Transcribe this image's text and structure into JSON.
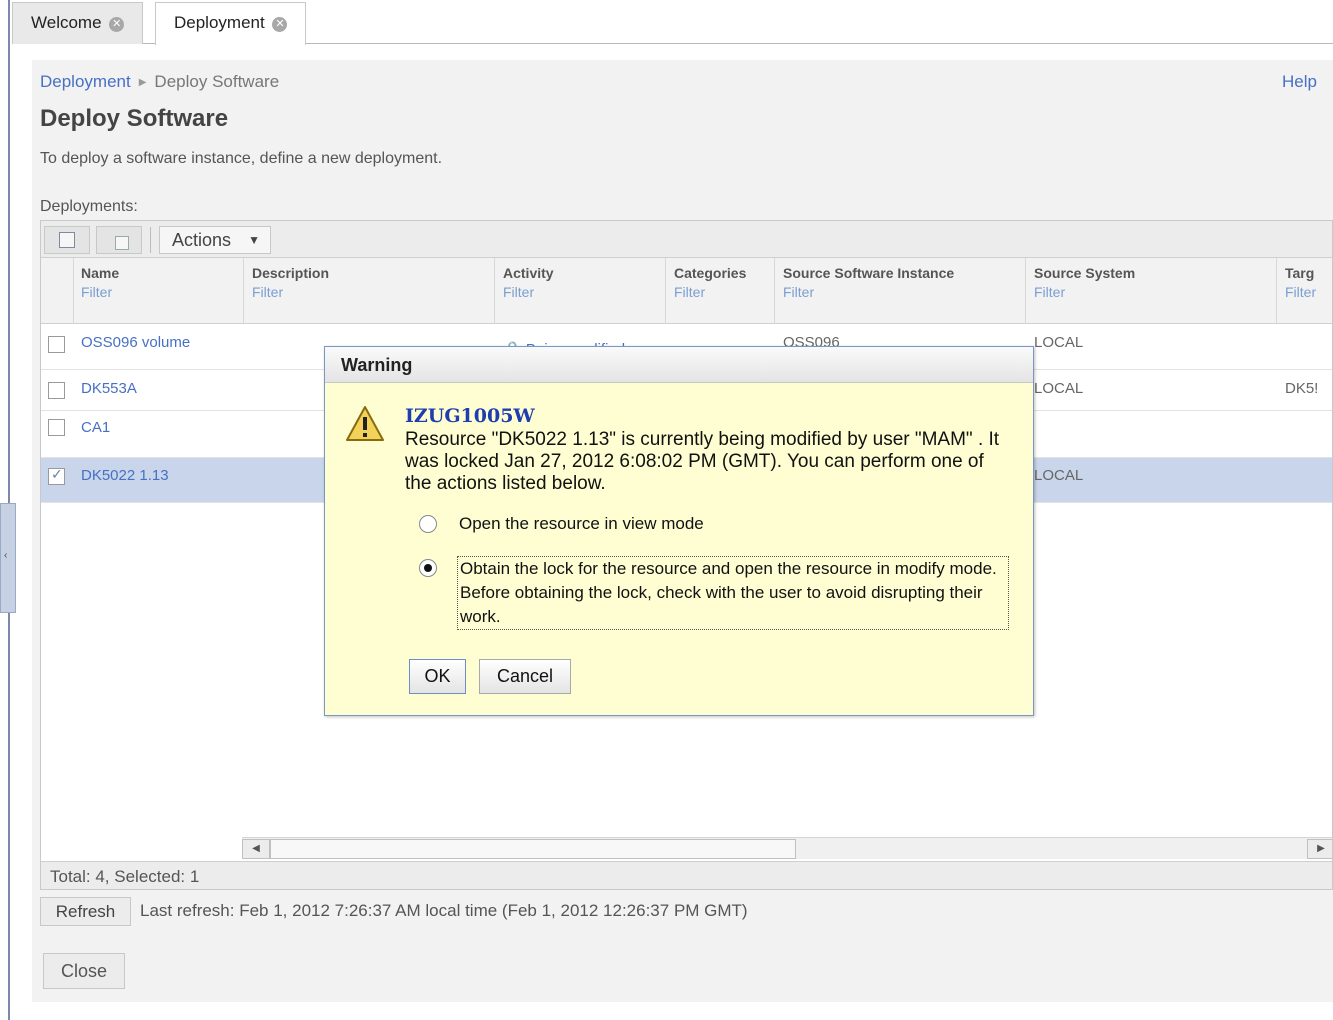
{
  "tabs": [
    {
      "label": "Welcome"
    },
    {
      "label": "Deployment"
    }
  ],
  "breadcrumb": {
    "parent": "Deployment",
    "current": "Deploy Software"
  },
  "help_label": "Help",
  "page_title": "Deploy Software",
  "intro_text": "To deploy a software instance, define a new deployment.",
  "deployments_label": "Deployments:",
  "toolbar": {
    "actions_label": "Actions"
  },
  "table": {
    "filter_label": "Filter",
    "columns": [
      {
        "name": "Name"
      },
      {
        "name": "Description"
      },
      {
        "name": "Activity"
      },
      {
        "name": "Categories"
      },
      {
        "name": "Source Software Instance"
      },
      {
        "name": "Source System"
      },
      {
        "name": "Targ"
      }
    ],
    "rows": [
      {
        "name": "OSS096 volume",
        "checked": false,
        "source_instance": "OSS096",
        "source_system": "LOCAL",
        "target": ""
      },
      {
        "name": "DK553A",
        "checked": false,
        "source_instance": "",
        "source_system": "LOCAL",
        "target": "DK5!"
      },
      {
        "name": "CA1",
        "checked": false,
        "source_instance": "",
        "source_system": "",
        "target": ""
      },
      {
        "name": "DK5022 1.13",
        "checked": true,
        "source_instance": "",
        "source_system": "LOCAL",
        "target": ""
      }
    ],
    "partial_activity": "Being modified"
  },
  "status": {
    "total_selected": "Total: 4, Selected: 1"
  },
  "refresh_label": "Refresh",
  "last_refresh": "Last refresh: Feb 1, 2012 7:26:37 AM local time (Feb 1, 2012 12:26:37 PM GMT)",
  "close_label": "Close",
  "dialog": {
    "title": "Warning",
    "message_id": "IZUG1005W",
    "message": "Resource \"DK5022 1.13\" is currently being modified by user \"MAM\" . It was locked Jan 27, 2012 6:08:02 PM (GMT). You can perform one of the actions listed below.",
    "option_view": "Open the resource in view mode",
    "option_modify": "Obtain the lock for the resource and open the resource in modify mode. Before obtaining the lock, check with the user to avoid disrupting their work.",
    "selected_option": "modify",
    "ok_label": "OK",
    "cancel_label": "Cancel"
  },
  "colors": {
    "link": "#4770c4",
    "message_id": "#1e3db0",
    "dialog_bg": "#fefed2",
    "selected_row": "#c9d5ea"
  },
  "icons": [
    "close-icon",
    "warning-icon",
    "chevron-right-icon",
    "caret-down-icon",
    "select-all-icon",
    "deselect-icon"
  ]
}
